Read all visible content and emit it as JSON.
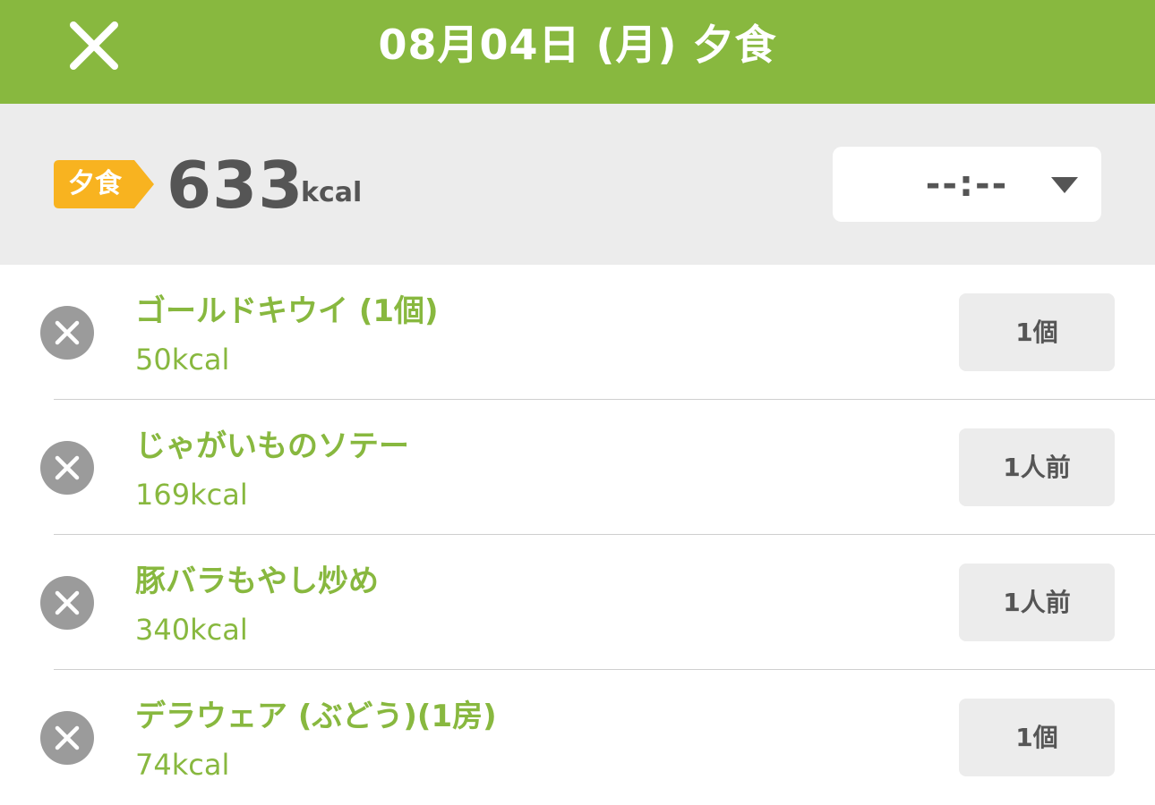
{
  "header": {
    "title": "08月04日 (月) 夕食",
    "close_icon": "close-icon"
  },
  "summary": {
    "meal_label": "夕食",
    "calories": "633",
    "calories_unit": "kcal",
    "time": "--:--",
    "badge_color": "#f8b320"
  },
  "colors": {
    "accent": "#88b83f",
    "text_dark": "#555555",
    "panel_bg": "#ececec",
    "remove_bg": "#9b9b9b"
  },
  "foods": [
    {
      "name": "ゴールドキウイ (1個)",
      "kcal": "50kcal",
      "portion": "1個"
    },
    {
      "name": "じゃがいものソテー",
      "kcal": "169kcal",
      "portion": "1人前"
    },
    {
      "name": "豚バラもやし炒め",
      "kcal": "340kcal",
      "portion": "1人前"
    },
    {
      "name": "デラウェア (ぶどう)(1房)",
      "kcal": "74kcal",
      "portion": "1個"
    }
  ]
}
